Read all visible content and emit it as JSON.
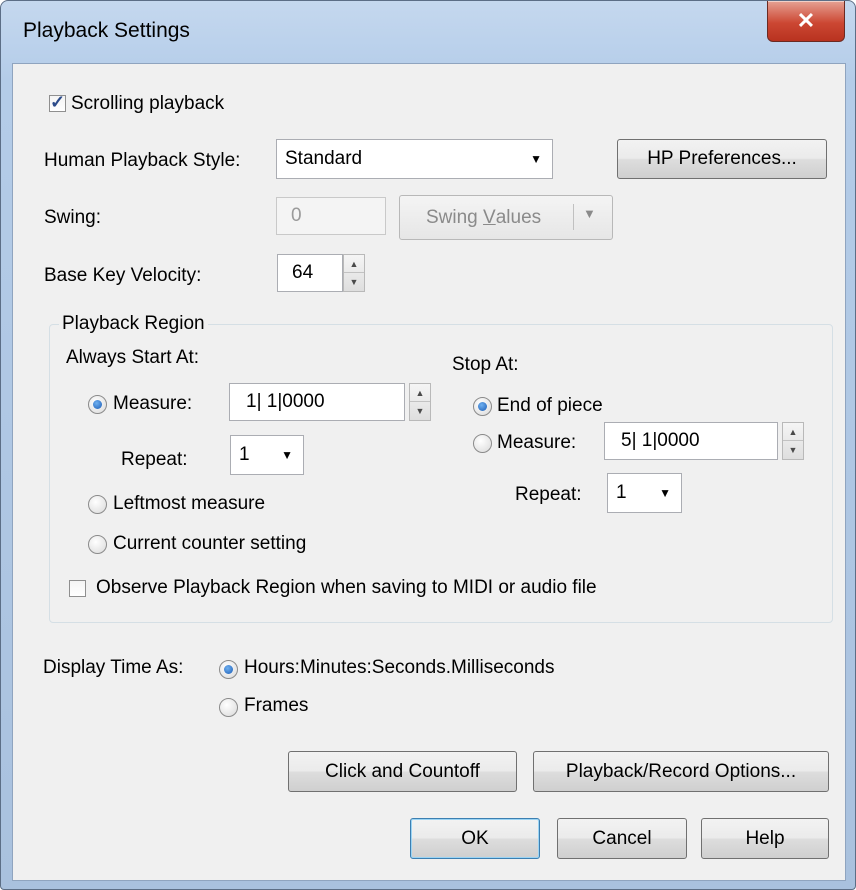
{
  "window": {
    "title": "Playback Settings",
    "close_glyph": "✕"
  },
  "scrolling_playback": {
    "label": "Scrolling playback",
    "checked": true
  },
  "human_playback": {
    "label": "Human Playback Style:",
    "value": "Standard",
    "preferences_button": "HP Preferences..."
  },
  "swing": {
    "label": "Swing:",
    "value": "0",
    "values_button_prefix": "Swing ",
    "values_button_underlined": "V",
    "values_button_suffix": "alues"
  },
  "base_key_velocity": {
    "label": "Base Key Velocity:",
    "value": "64"
  },
  "playback_region": {
    "title": "Playback Region",
    "start": {
      "heading": "Always Start At:",
      "measure_label": "Measure:",
      "measure_value": "1| 1|0000",
      "repeat_label": "Repeat:",
      "repeat_value": "1",
      "leftmost_label": "Leftmost measure",
      "current_counter_label": "Current counter setting",
      "selected": "measure"
    },
    "stop": {
      "heading": "Stop At:",
      "end_label": "End of piece",
      "measure_label": "Measure:",
      "measure_value": "5| 1|0000",
      "repeat_label": "Repeat:",
      "repeat_value": "1",
      "selected": "end"
    },
    "observe_label": "Observe Playback Region when saving to MIDI or audio file",
    "observe_checked": false
  },
  "display_time": {
    "label": "Display Time As:",
    "hms_label": "Hours:Minutes:Seconds.Milliseconds",
    "frames_label": "Frames",
    "selected": "hms"
  },
  "buttons": {
    "click_countoff": "Click and Countoff",
    "playback_record": "Playback/Record Options...",
    "ok": "OK",
    "cancel": "Cancel",
    "help": "Help"
  },
  "icons": {
    "check": "✓",
    "dropdown": "▼",
    "spin_up": "▲",
    "spin_down": "▼"
  }
}
